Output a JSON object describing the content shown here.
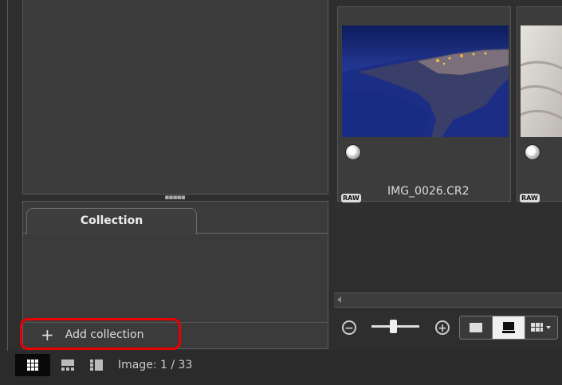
{
  "splitter": {
    "handle": "▪▪▪▪▪"
  },
  "collection": {
    "tab_label": "Collection",
    "add_icon": "+",
    "add_label": "Add collection"
  },
  "thumbnails": [
    {
      "raw_badge": "RAW",
      "filename": "IMG_0026.CR2",
      "status_icon": "rating-circle-icon"
    },
    {
      "raw_badge": "RAW",
      "filename": "",
      "status_icon": "rating-circle-icon"
    }
  ],
  "zoom": {
    "minus_symbol": "−",
    "plus_symbol": "+"
  },
  "status": {
    "image_count": "Image: 1 / 33"
  },
  "colors": {
    "highlight": "#e80000",
    "background": "#2e2e2e",
    "panel": "#3b3b3b"
  }
}
